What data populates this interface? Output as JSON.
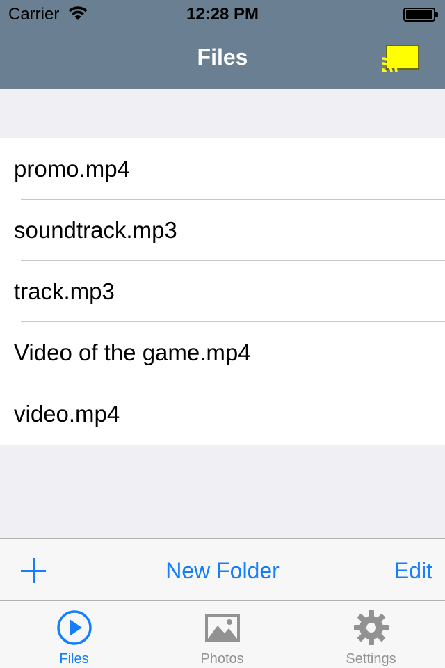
{
  "status_bar": {
    "carrier": "Carrier",
    "time": "12:28 PM"
  },
  "nav": {
    "title": "Files",
    "cast_icon": "cast-icon",
    "cast_color": "#ffff00"
  },
  "files": [
    {
      "name": "promo.mp4"
    },
    {
      "name": "soundtrack.mp3"
    },
    {
      "name": "track.mp3"
    },
    {
      "name": "Video of the game.mp4"
    },
    {
      "name": "video.mp4"
    }
  ],
  "toolbar": {
    "add_icon": "plus-icon",
    "new_folder_label": "New Folder",
    "edit_label": "Edit"
  },
  "tabs": [
    {
      "label": "Files",
      "icon": "play-circle-icon",
      "active": true
    },
    {
      "label": "Photos",
      "icon": "photo-icon",
      "active": false
    },
    {
      "label": "Settings",
      "icon": "gear-icon",
      "active": false
    }
  ],
  "colors": {
    "nav_bar": "#6a7f91",
    "accent": "#157efb",
    "inactive": "#929292",
    "background": "#efeff4"
  }
}
